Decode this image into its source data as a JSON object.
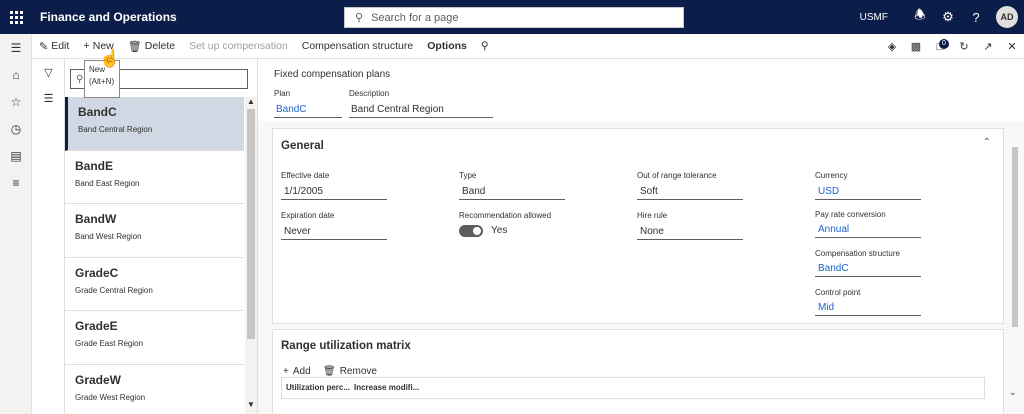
{
  "topbar": {
    "title": "Finance and Operations",
    "search_placeholder": "Search for a page",
    "company": "USMF",
    "avatar_initials": "AD"
  },
  "actions": {
    "edit": "Edit",
    "new": "New",
    "delete": "Delete",
    "setup_compensation": "Set up compensation",
    "compensation_structure": "Compensation structure",
    "options": "Options",
    "notification_count": "0"
  },
  "tooltip": {
    "title": "New",
    "shortcut": "(Alt+N)"
  },
  "list": {
    "items": [
      {
        "title": "BandC",
        "subtitle": "Band Central Region",
        "selected": true
      },
      {
        "title": "BandE",
        "subtitle": "Band East Region",
        "selected": false
      },
      {
        "title": "BandW",
        "subtitle": "Band West Region",
        "selected": false
      },
      {
        "title": "GradeC",
        "subtitle": "Grade Central Region",
        "selected": false
      },
      {
        "title": "GradeE",
        "subtitle": "Grade East Region",
        "selected": false
      },
      {
        "title": "GradeW",
        "subtitle": "Grade West Region",
        "selected": false
      }
    ]
  },
  "header": {
    "caption": "Fixed compensation plans",
    "plan_label": "Plan",
    "plan_value": "BandC",
    "description_label": "Description",
    "description_value": "Band Central Region"
  },
  "general": {
    "title": "General",
    "effective_date_label": "Effective date",
    "effective_date": "1/1/2005",
    "expiration_date_label": "Expiration date",
    "expiration_date": "Never",
    "type_label": "Type",
    "type": "Band",
    "recommendation_label": "Recommendation allowed",
    "recommendation": "Yes",
    "tolerance_label": "Out of range tolerance",
    "tolerance": "Soft",
    "hire_rule_label": "Hire rule",
    "hire_rule": "None",
    "currency_label": "Currency",
    "currency": "USD",
    "pay_rate_label": "Pay rate conversion",
    "pay_rate": "Annual",
    "comp_structure_label": "Compensation structure",
    "comp_structure": "BandC",
    "control_point_label": "Control point",
    "control_point": "Mid"
  },
  "matrix": {
    "title": "Range utilization matrix",
    "add": "Add",
    "remove": "Remove",
    "columns": [
      "Utilization perc...",
      "Increase modifi..."
    ]
  }
}
